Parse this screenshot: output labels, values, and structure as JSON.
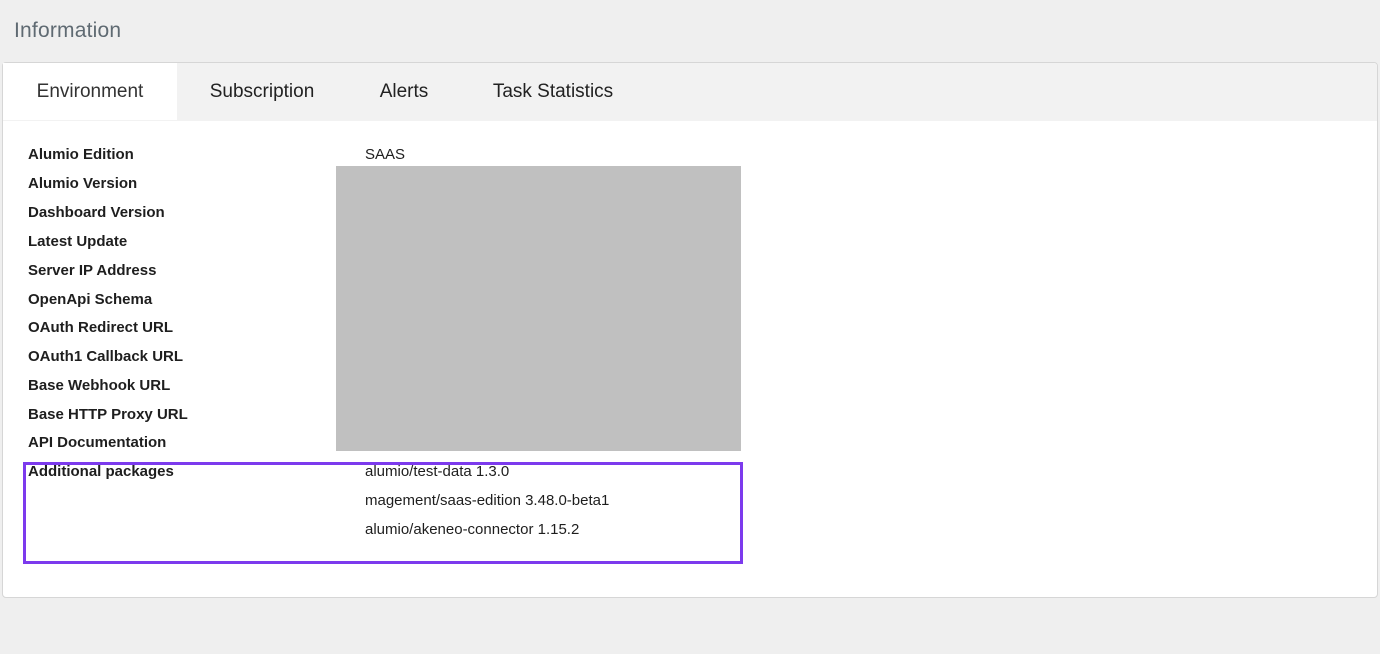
{
  "page": {
    "title": "Information"
  },
  "tabs": [
    {
      "label": "Environment",
      "active": true
    },
    {
      "label": "Subscription",
      "active": false
    },
    {
      "label": "Alerts",
      "active": false
    },
    {
      "label": "Task Statistics",
      "active": false
    }
  ],
  "environment": {
    "rows": [
      {
        "label": "Alumio Edition",
        "value": "SAAS"
      },
      {
        "label": "Alumio Version",
        "value": ""
      },
      {
        "label": "Dashboard Version",
        "value": ""
      },
      {
        "label": "Latest Update",
        "value": ""
      },
      {
        "label": "Server IP Address",
        "value": ""
      },
      {
        "label": "OpenApi Schema",
        "value": ""
      },
      {
        "label": "OAuth Redirect URL",
        "value": ""
      },
      {
        "label": "OAuth1 Callback URL",
        "value": ""
      },
      {
        "label": "Base Webhook URL",
        "value": ""
      },
      {
        "label": "Base HTTP Proxy URL",
        "value": ""
      },
      {
        "label": "API Documentation",
        "value": ""
      }
    ],
    "additional_packages": {
      "label": "Additional packages",
      "items": [
        "alumio/test-data 1.3.0",
        "magement/saas-edition 3.48.0-beta1",
        "alumio/akeneo-connector 1.15.2"
      ]
    }
  },
  "colors": {
    "highlight_border": "#7c3aed",
    "redaction": "#c0c0c0",
    "background": "#efefef"
  }
}
